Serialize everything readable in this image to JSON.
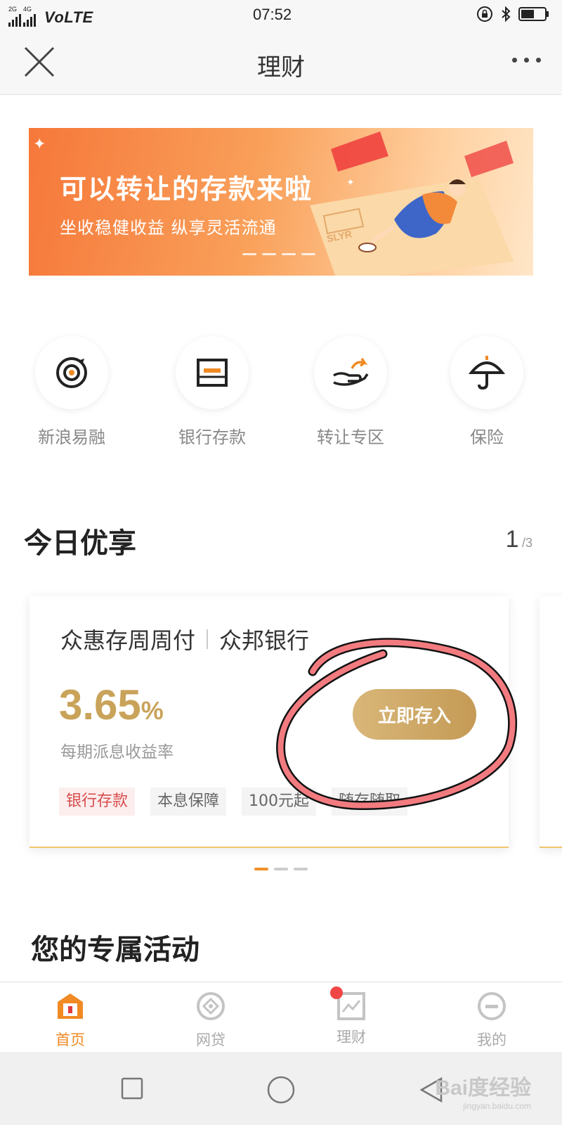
{
  "status_bar": {
    "net_top": "2G",
    "net_bottom": "4G",
    "volte": "VoLTE",
    "time": "07:52",
    "icons": [
      "rotation-lock-icon",
      "bluetooth-icon",
      "battery-icon"
    ]
  },
  "nav": {
    "title": "理财",
    "close_icon": "close-icon",
    "more_icon": "more-dots-icon"
  },
  "banner": {
    "title": "可以转让的存款来啦",
    "subtitle": "坐收稳健收益 纵享灵活流通",
    "card_text": "SLYR"
  },
  "entries": [
    {
      "label": "新浪易融",
      "icon": "target-icon"
    },
    {
      "label": "银行存款",
      "icon": "bank-card-icon"
    },
    {
      "label": "转让专区",
      "icon": "hand-transfer-icon"
    },
    {
      "label": "保险",
      "icon": "umbrella-icon"
    }
  ],
  "today": {
    "title": "今日优享",
    "page_current": "1",
    "page_total": "/3"
  },
  "card": {
    "product": "众惠存周周付",
    "bank": "众邦银行",
    "rate_value": "3.65",
    "rate_unit": "%",
    "rate_label": "每期派息收益率",
    "cta": "立即存入",
    "tags": [
      "银行存款",
      "本息保障",
      "100元起",
      "随存随取"
    ]
  },
  "activities": {
    "title": "您的专属活动"
  },
  "tabbar": [
    {
      "label": "首页",
      "icon": "home-icon",
      "active": true
    },
    {
      "label": "网贷",
      "icon": "loan-icon",
      "active": false
    },
    {
      "label": "理财",
      "icon": "finance-chart-icon",
      "active": false
    },
    {
      "label": "我的",
      "icon": "profile-icon",
      "active": false
    }
  ],
  "system_nav": {
    "icons": [
      "recent-apps-icon",
      "home-circle-icon",
      "back-icon"
    ],
    "watermark_big": "Bai度经验",
    "watermark_small": "jingyan.baidu.com"
  },
  "colors": {
    "accent_orange": "#f08a24",
    "gold": "#c9a35a",
    "red_tag": "#d84c4c",
    "annotation": "#f27b80"
  }
}
